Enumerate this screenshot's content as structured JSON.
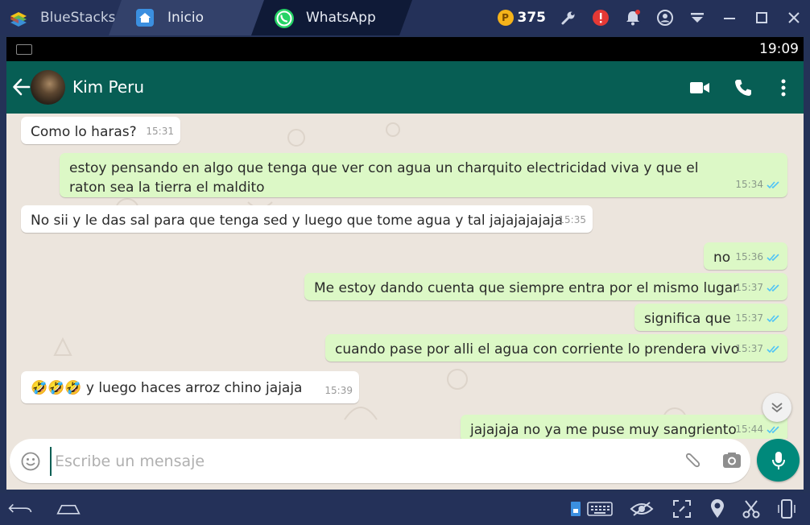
{
  "window": {
    "app_name": "BlueStacks",
    "tabs": [
      {
        "label": "Inicio",
        "icon": "home-icon"
      },
      {
        "label": "WhatsApp",
        "icon": "whatsapp-icon"
      }
    ],
    "coins": "375",
    "coin_symbol": "P"
  },
  "status_bar": {
    "time": "19:09"
  },
  "chat_header": {
    "contact_name": "Kim Peru"
  },
  "messages": [
    {
      "dir": "in",
      "text": "Como lo haras?",
      "time": "15:31"
    },
    {
      "dir": "out",
      "text": "estoy pensando en algo que tenga que ver con agua un charquito electricidad viva y que el raton sea la tierra el maldito",
      "time": "15:34"
    },
    {
      "dir": "in",
      "text": "No sii y le das sal para que tenga sed y luego que tome agua y tal jajajajajaja",
      "time": "15:35"
    },
    {
      "dir": "out",
      "text": "no",
      "time": "15:36"
    },
    {
      "dir": "out",
      "text": "Me estoy dando cuenta que siempre entra por el mismo lugar",
      "time": "15:37"
    },
    {
      "dir": "out",
      "text": "significa que",
      "time": "15:37"
    },
    {
      "dir": "out",
      "text": "cuando pase por alli el agua con corriente lo prendera vivo",
      "time": "15:37"
    },
    {
      "dir": "in",
      "text": "🤣🤣🤣 y luego haces arroz chino jajaja",
      "time": "15:39"
    },
    {
      "dir": "out",
      "text": "jajajaja no ya me puse muy sangriento",
      "time": "15:44"
    }
  ],
  "composer": {
    "placeholder": "Escribe un mensaje"
  },
  "colors": {
    "header": "#075e54",
    "outgoing": "#dcf8c6",
    "incoming": "#ffffff",
    "wallpaper": "#ece5dd",
    "read_ticks": "#4fc3f7",
    "mic": "#00897b"
  }
}
